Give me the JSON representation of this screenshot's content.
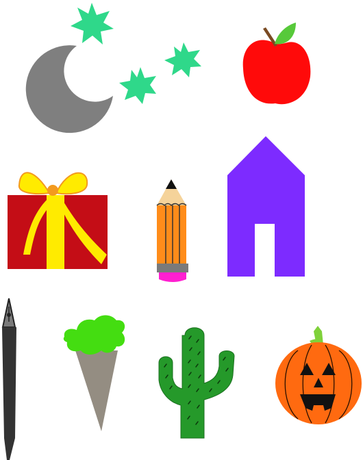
{
  "clipart": {
    "items": [
      {
        "name": "moon-icon"
      },
      {
        "name": "stars-icon"
      },
      {
        "name": "apple-icon"
      },
      {
        "name": "gift-icon"
      },
      {
        "name": "pencil-icon"
      },
      {
        "name": "house-icon"
      },
      {
        "name": "fountain-pen-icon"
      },
      {
        "name": "ice-cream-cone-icon"
      },
      {
        "name": "cactus-icon"
      },
      {
        "name": "jack-o-lantern-icon"
      }
    ]
  },
  "colors": {
    "background": "#ffffff",
    "moon": "#7f7f7f",
    "star": "#2fd88a",
    "apple": "#ff0a0a",
    "apple_leaf": "#57c93a",
    "apple_stem": "#7a4a22",
    "gift_box": "#c40d16",
    "gift_ribbon": "#ffeb00",
    "gift_bow_outline": "#f39a1f",
    "pencil_body": "#ff8c1a",
    "pencil_ferrule": "#7a7a7a",
    "pencil_eraser": "#ff1fd1",
    "pencil_wood": "#f5d39a",
    "house": "#7d2bff",
    "pen": "#333333",
    "ice_cream": "#44dd11",
    "cone": "#948d82",
    "cactus": "#25992a",
    "pumpkin": "#ff6a10",
    "pumpkin_stem": "#7fd13a",
    "pumpkin_face": "#111111"
  }
}
